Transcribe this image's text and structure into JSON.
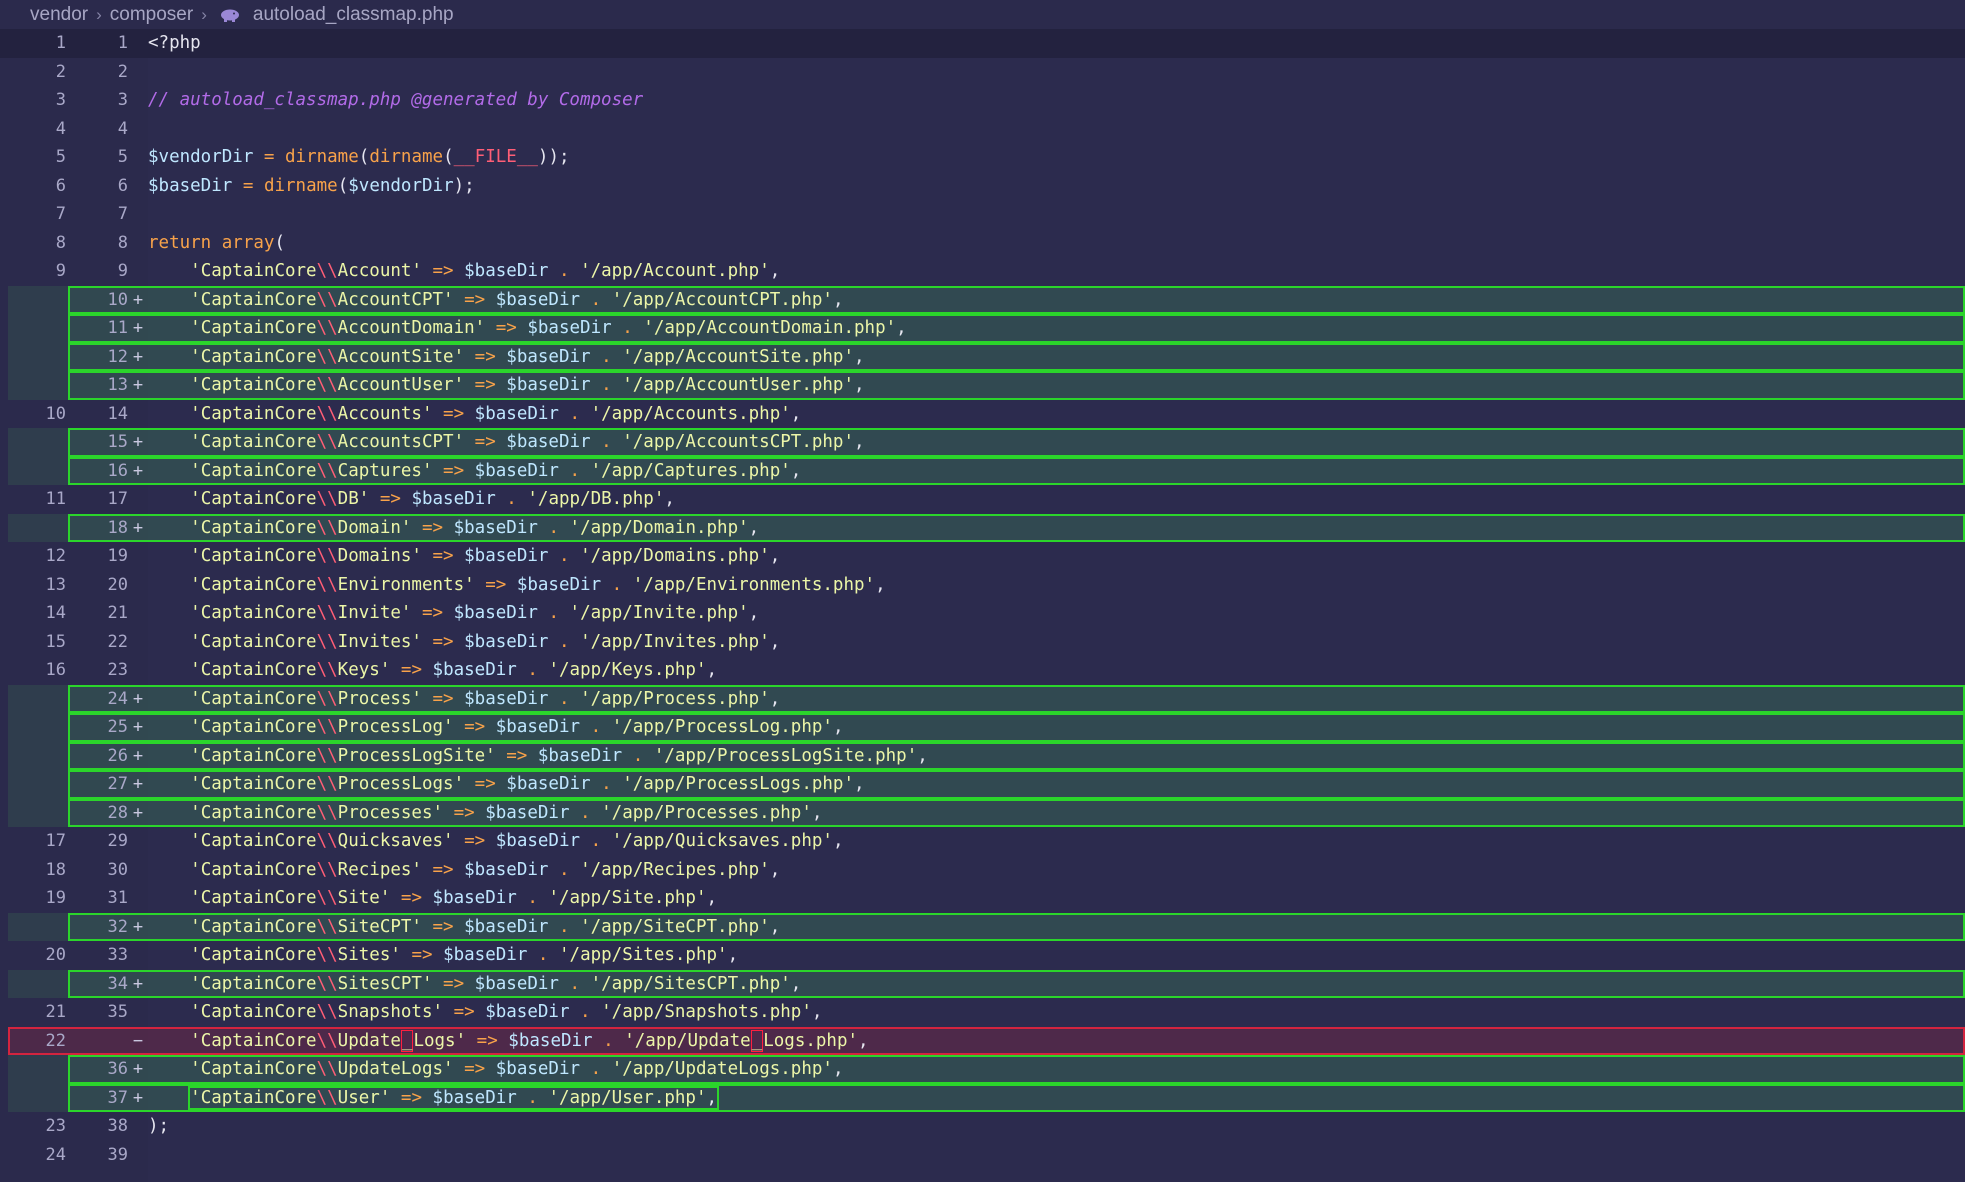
{
  "breadcrumb": {
    "items": [
      "vendor",
      "composer"
    ],
    "file": "autoload_classmap.php",
    "file_icon": "php-elephant-icon"
  },
  "colors": {
    "added": "#2bd52b",
    "removed": "#d4243f",
    "background": "#2b2a4c"
  },
  "header_lines": [
    {
      "old": "1",
      "new": "1",
      "text": "<?php"
    },
    {
      "old": "2",
      "new": "2",
      "text": ""
    },
    {
      "old": "3",
      "new": "3",
      "text": "// autoload_classmap.php @generated by Composer"
    },
    {
      "old": "4",
      "new": "4",
      "text": ""
    },
    {
      "old": "5",
      "new": "5",
      "text": "$vendorDir = dirname(dirname(__FILE__));"
    },
    {
      "old": "6",
      "new": "6",
      "text": "$baseDir = dirname($vendorDir);"
    },
    {
      "old": "7",
      "new": "7",
      "text": ""
    },
    {
      "old": "8",
      "new": "8",
      "text": "return array("
    }
  ],
  "entries": [
    {
      "old": "9",
      "new": "9",
      "status": "same",
      "cls": "Account",
      "path": "/app/Account.php"
    },
    {
      "old": "",
      "new": "10",
      "status": "added",
      "cls": "AccountCPT",
      "path": "/app/AccountCPT.php"
    },
    {
      "old": "",
      "new": "11",
      "status": "added",
      "cls": "AccountDomain",
      "path": "/app/AccountDomain.php"
    },
    {
      "old": "",
      "new": "12",
      "status": "added",
      "cls": "AccountSite",
      "path": "/app/AccountSite.php"
    },
    {
      "old": "",
      "new": "13",
      "status": "added",
      "cls": "AccountUser",
      "path": "/app/AccountUser.php"
    },
    {
      "old": "10",
      "new": "14",
      "status": "same",
      "cls": "Accounts",
      "path": "/app/Accounts.php"
    },
    {
      "old": "",
      "new": "15",
      "status": "added",
      "cls": "AccountsCPT",
      "path": "/app/AccountsCPT.php"
    },
    {
      "old": "",
      "new": "16",
      "status": "added",
      "cls": "Captures",
      "path": "/app/Captures.php"
    },
    {
      "old": "11",
      "new": "17",
      "status": "same",
      "cls": "DB",
      "path": "/app/DB.php"
    },
    {
      "old": "",
      "new": "18",
      "status": "added",
      "cls": "Domain",
      "path": "/app/Domain.php"
    },
    {
      "old": "12",
      "new": "19",
      "status": "same",
      "cls": "Domains",
      "path": "/app/Domains.php"
    },
    {
      "old": "13",
      "new": "20",
      "status": "same",
      "cls": "Environments",
      "path": "/app/Environments.php"
    },
    {
      "old": "14",
      "new": "21",
      "status": "same",
      "cls": "Invite",
      "path": "/app/Invite.php"
    },
    {
      "old": "15",
      "new": "22",
      "status": "same",
      "cls": "Invites",
      "path": "/app/Invites.php"
    },
    {
      "old": "16",
      "new": "23",
      "status": "same",
      "cls": "Keys",
      "path": "/app/Keys.php"
    },
    {
      "old": "",
      "new": "24",
      "status": "added",
      "cls": "Process",
      "path": "/app/Process.php"
    },
    {
      "old": "",
      "new": "25",
      "status": "added",
      "cls": "ProcessLog",
      "path": "/app/ProcessLog.php"
    },
    {
      "old": "",
      "new": "26",
      "status": "added",
      "cls": "ProcessLogSite",
      "path": "/app/ProcessLogSite.php"
    },
    {
      "old": "",
      "new": "27",
      "status": "added",
      "cls": "ProcessLogs",
      "path": "/app/ProcessLogs.php"
    },
    {
      "old": "",
      "new": "28",
      "status": "added",
      "cls": "Processes",
      "path": "/app/Processes.php"
    },
    {
      "old": "17",
      "new": "29",
      "status": "same",
      "cls": "Quicksaves",
      "path": "/app/Quicksaves.php"
    },
    {
      "old": "18",
      "new": "30",
      "status": "same",
      "cls": "Recipes",
      "path": "/app/Recipes.php"
    },
    {
      "old": "19",
      "new": "31",
      "status": "same",
      "cls": "Site",
      "path": "/app/Site.php"
    },
    {
      "old": "",
      "new": "32",
      "status": "added",
      "cls": "SiteCPT",
      "path": "/app/SiteCPT.php"
    },
    {
      "old": "20",
      "new": "33",
      "status": "same",
      "cls": "Sites",
      "path": "/app/Sites.php"
    },
    {
      "old": "",
      "new": "34",
      "status": "added",
      "cls": "SitesCPT",
      "path": "/app/SitesCPT.php"
    },
    {
      "old": "21",
      "new": "35",
      "status": "same",
      "cls": "Snapshots",
      "path": "/app/Snapshots.php"
    },
    {
      "old": "22",
      "new": "",
      "status": "removed",
      "cls": "Update_Logs",
      "path": "/app/Update_Logs.php"
    },
    {
      "old": "",
      "new": "36",
      "status": "added",
      "cls": "UpdateLogs",
      "path": "/app/UpdateLogs.php"
    },
    {
      "old": "",
      "new": "37",
      "status": "added",
      "cls": "User",
      "path": "/app/User.php"
    }
  ],
  "footer_lines": [
    {
      "old": "23",
      "new": "38",
      "text": ");"
    },
    {
      "old": "24",
      "new": "39",
      "text": ""
    }
  ],
  "markers": {
    "added": "+",
    "removed": "−"
  }
}
